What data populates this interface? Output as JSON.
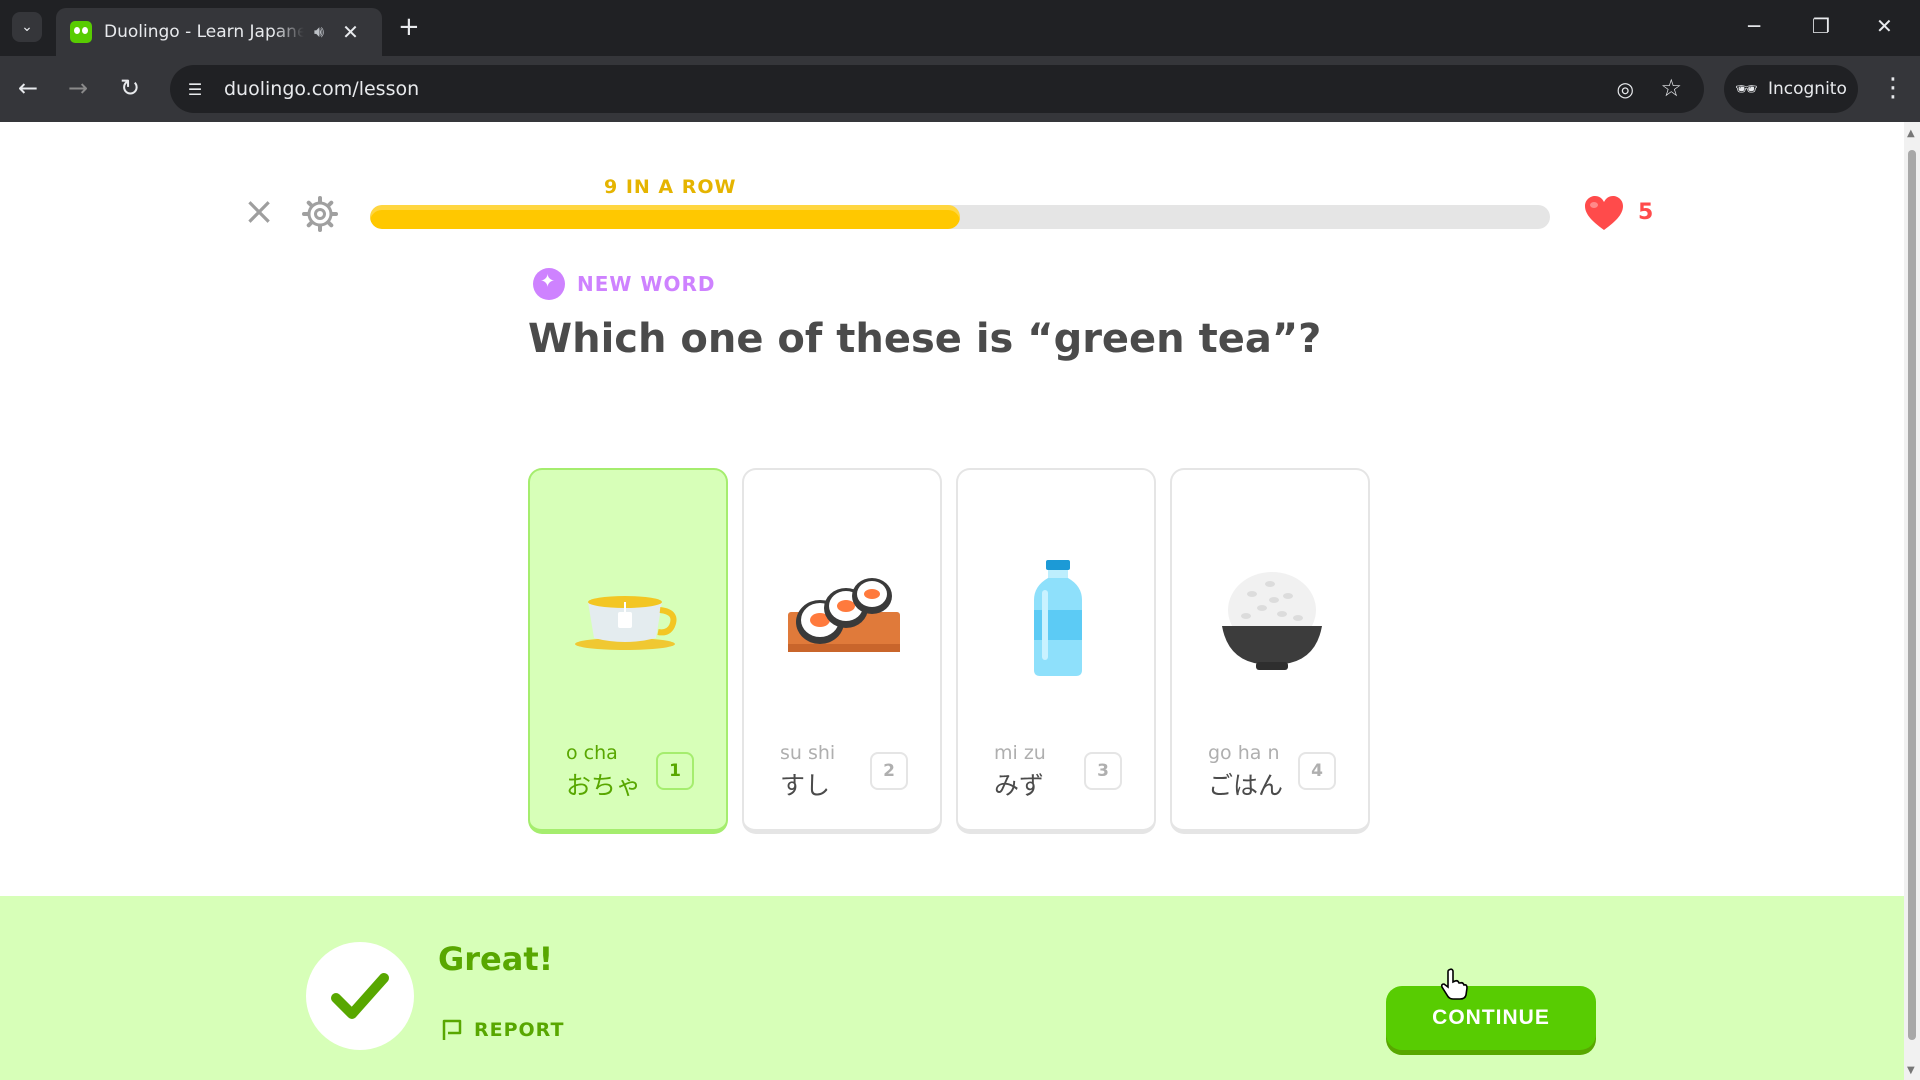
{
  "browser": {
    "tab_title": "Duolingo - Learn Japanese",
    "url": "duolingo.com/lesson",
    "profile_label": "Incognito"
  },
  "lesson": {
    "streak_label": "9 IN A ROW",
    "progress_fraction": 0.5,
    "hearts": "5",
    "badge_label": "NEW WORD",
    "question": "Which one of these is “green tea”?",
    "choices": [
      {
        "romaji": "o  cha",
        "kana": "おちゃ",
        "number": "1",
        "icon": "green-tea-cup-icon",
        "selected": true
      },
      {
        "romaji": "su shi",
        "kana": "すし",
        "number": "2",
        "icon": "sushi-icon",
        "selected": false
      },
      {
        "romaji": "mi zu",
        "kana": "みず",
        "number": "3",
        "icon": "water-bottle-icon",
        "selected": false
      },
      {
        "romaji": "go ha  n",
        "kana": "ごはん",
        "number": "4",
        "icon": "rice-bowl-icon",
        "selected": false
      }
    ]
  },
  "feedback": {
    "title": "Great!",
    "report_label": "REPORT",
    "continue_label": "CONTINUE"
  },
  "colors": {
    "brand_green": "#58cc02",
    "correct_bg": "#d7ffb8",
    "progress_yellow": "#ffc800",
    "heart_red": "#ff4b4b",
    "new_word_purple": "#ce82ff"
  }
}
